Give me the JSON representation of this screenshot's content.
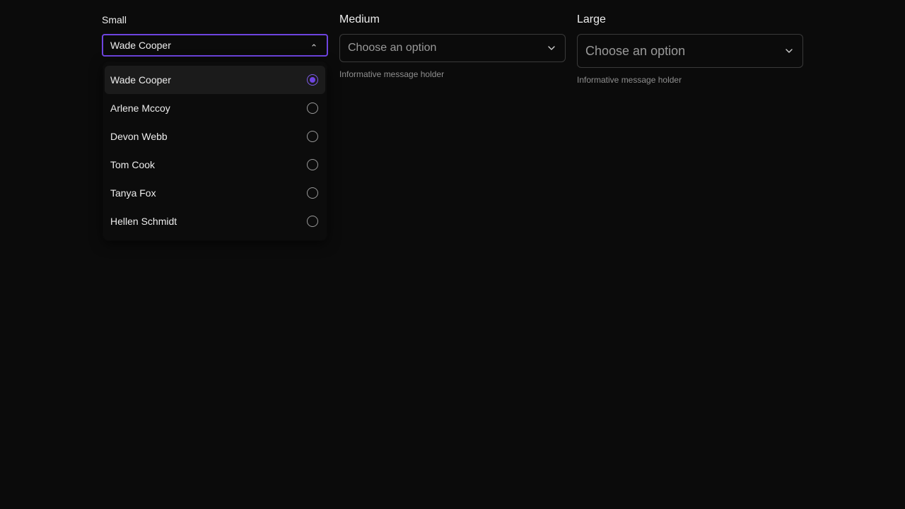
{
  "colors": {
    "background": "#0b0b0b",
    "accent": "#6e44e0",
    "text": "#ededed",
    "muted": "#9a9a9a",
    "border": "#3a3a3a"
  },
  "small": {
    "label": "Small",
    "value": "Wade Cooper",
    "expanded": true,
    "icon": "chevron-up-icon",
    "options": [
      {
        "label": "Wade Cooper",
        "selected": true
      },
      {
        "label": "Arlene Mccoy",
        "selected": false
      },
      {
        "label": "Devon Webb",
        "selected": false
      },
      {
        "label": "Tom Cook",
        "selected": false
      },
      {
        "label": "Tanya Fox",
        "selected": false
      },
      {
        "label": "Hellen Schmidt",
        "selected": false
      }
    ]
  },
  "medium": {
    "label": "Medium",
    "placeholder": "Choose an option",
    "helper": "Informative message holder",
    "icon": "chevron-down-icon"
  },
  "large": {
    "label": "Large",
    "placeholder": "Choose an option",
    "helper": "Informative message holder",
    "icon": "chevron-down-icon"
  }
}
